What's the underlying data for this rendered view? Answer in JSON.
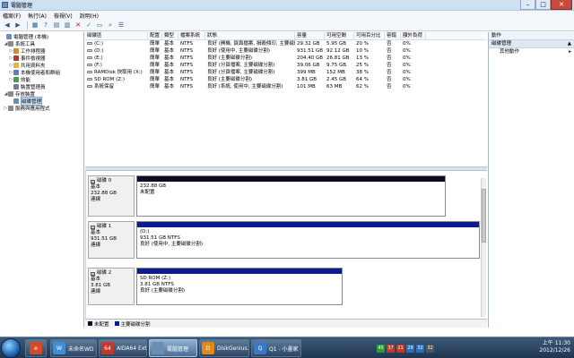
{
  "window": {
    "title": "電腦管理"
  },
  "menu": [
    "檔案(F)",
    "執行(A)",
    "檢視(V)",
    "說明(H)"
  ],
  "tree": [
    {
      "label": "電腦管理 (本機)",
      "level": 0,
      "expander": "",
      "icon": "#6a8fb5",
      "selected": false
    },
    {
      "label": "系統工具",
      "level": 1,
      "expander": "◢",
      "icon": "#8a8a8a",
      "selected": false
    },
    {
      "label": "工作排程器",
      "level": 2,
      "expander": "▷",
      "icon": "#d08d2a",
      "selected": false
    },
    {
      "label": "事件檢視器",
      "level": 2,
      "expander": "▷",
      "icon": "#b03a2e",
      "selected": false
    },
    {
      "label": "共用資料夾",
      "level": 2,
      "expander": "▷",
      "icon": "#e0b64a",
      "selected": false
    },
    {
      "label": "本機使用者和群組",
      "level": 2,
      "expander": "▷",
      "icon": "#5b7fb1",
      "selected": false
    },
    {
      "label": "效能",
      "level": 2,
      "expander": "▷",
      "icon": "#4f9a4f",
      "selected": false
    },
    {
      "label": "裝置管理員",
      "level": 2,
      "expander": "",
      "icon": "#7a7a9a",
      "selected": false
    },
    {
      "label": "存放裝置",
      "level": 1,
      "expander": "◢",
      "icon": "#8a8a8a",
      "selected": false
    },
    {
      "label": "磁碟管理",
      "level": 2,
      "expander": "",
      "icon": "#6a8fb5",
      "selected": true
    },
    {
      "label": "服務與應用程式",
      "level": 1,
      "expander": "▷",
      "icon": "#8a8a8a",
      "selected": false
    }
  ],
  "volume_table": {
    "columns": [
      "磁碟區",
      "配置",
      "類型",
      "檔案系統",
      "狀態",
      "容量",
      "可用空間",
      "可用百分比",
      "容錯",
      "額外負荷"
    ],
    "rows": [
      [
        "(C:)",
        "簡單",
        "基本",
        "NTFS",
        "良好 (開機, 頁面檔案, 損毀傾印, 主要磁碟分割)",
        "29.32 GB",
        "5.95 GB",
        "20 %",
        "否",
        "0%"
      ],
      [
        "(D:)",
        "簡單",
        "基本",
        "NTFS",
        "良好 (使用中, 主要磁碟分割)",
        "931.51 GB",
        "92.12 GB",
        "10 %",
        "否",
        "0%"
      ],
      [
        "(E:)",
        "簡單",
        "基本",
        "NTFS",
        "良好 (主要磁碟分割)",
        "204.40 GB",
        "26.81 GB",
        "13 %",
        "否",
        "0%"
      ],
      [
        "(F:)",
        "簡單",
        "基本",
        "NTFS",
        "良好 (分頁檔案, 主要磁碟分割)",
        "39.06 GB",
        "9.75 GB",
        "25 %",
        "否",
        "0%"
      ],
      [
        "RAMDisk 快取用 (X:)",
        "簡單",
        "基本",
        "NTFS",
        "良好 (分頁檔案, 主要磁碟分割)",
        "399 MB",
        "152 MB",
        "38 %",
        "否",
        "0%"
      ],
      [
        "SD ROM (Z:)",
        "簡單",
        "基本",
        "NTFS",
        "良好 (主要磁碟分割)",
        "3.81 GB",
        "2.45 GB",
        "64 %",
        "否",
        "0%"
      ],
      [
        "系統保留",
        "簡單",
        "基本",
        "NTFS",
        "良好 (系統, 使用中, 主要磁碟分割)",
        "101 MB",
        "63 MB",
        "62 %",
        "否",
        "0%"
      ]
    ]
  },
  "disks": [
    {
      "name": "磁碟 0",
      "type": "基本",
      "size": "232.88 GB",
      "status": "連線",
      "partition": {
        "title": "",
        "line1": "232.88 GB",
        "line2": "未配置",
        "unallocated": true
      }
    },
    {
      "name": "磁碟 1",
      "type": "基本",
      "size": "931.51 GB",
      "status": "連線",
      "partition": {
        "title": "(D:)",
        "line1": "931.51 GB NTFS",
        "line2": "良好 (使用中, 主要磁碟分割)",
        "unallocated": false
      }
    },
    {
      "name": "磁碟 2",
      "type": "基本",
      "size": "3.81 GB",
      "status": "連線",
      "partition": {
        "title": "SD ROM  (Z:)",
        "line1": "3.81 GB NTFS",
        "line2": "良好 (主要磁碟分割)",
        "unallocated": false
      }
    }
  ],
  "legend": {
    "unallocated": "未配置",
    "primary": "主要磁碟分割",
    "colors": {
      "unallocated": "#0e0e22",
      "primary": "#0b1d8e"
    }
  },
  "actions": {
    "header": "動作",
    "section": "磁碟管理",
    "item": "其他動作"
  },
  "taskbar": {
    "apps": [
      {
        "label": "",
        "color": "#d44a2a",
        "icon_text": "e",
        "icononly": true
      },
      {
        "label": "未命名WD ...",
        "color": "#3f8fd6",
        "icon_text": "W",
        "icononly": false
      },
      {
        "label": "AIDA64 Ext...",
        "color": "#c0392b",
        "icon_text": "64",
        "icononly": false
      },
      {
        "label": "電腦管理",
        "color": "#6a8fb5",
        "icon_text": "",
        "icononly": false,
        "active": true
      },
      {
        "label": "DiskGenius...",
        "color": "#e08a1e",
        "icon_text": "D",
        "icononly": false
      },
      {
        "label": "Q1 - 小畫家",
        "color": "#3c78c8",
        "icon_text": "Q",
        "icononly": false
      }
    ],
    "tray": [
      "45",
      "37",
      "21",
      "29",
      "32",
      "32"
    ],
    "clock": {
      "time": "上午 11:30",
      "date": "2012/12/26"
    }
  }
}
